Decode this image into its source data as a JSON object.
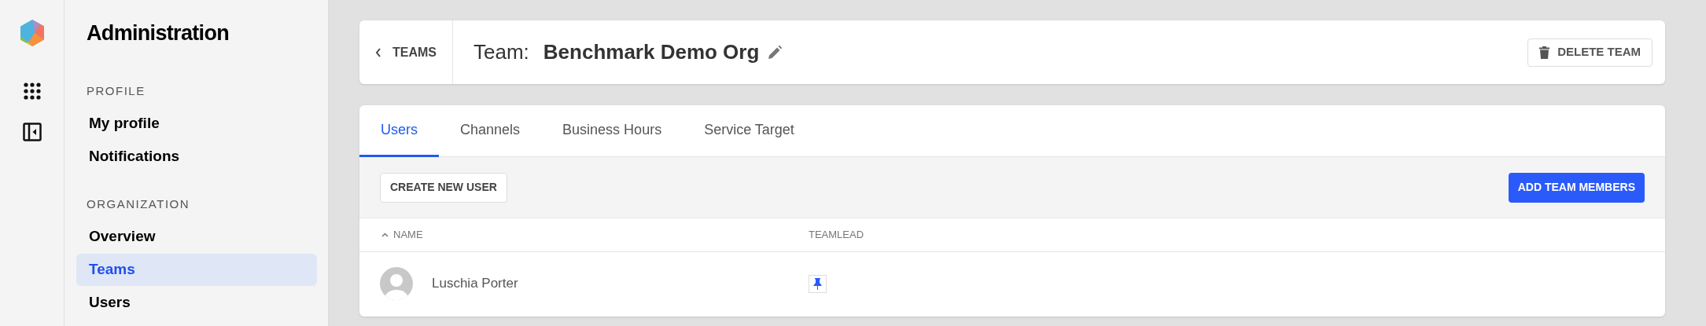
{
  "sidebar": {
    "title": "Administration",
    "sections": [
      {
        "heading": "PROFILE",
        "items": [
          {
            "label": "My profile",
            "selected": false
          },
          {
            "label": "Notifications",
            "selected": false
          }
        ]
      },
      {
        "heading": "ORGANIZATION",
        "items": [
          {
            "label": "Overview",
            "selected": false
          },
          {
            "label": "Teams",
            "selected": true
          },
          {
            "label": "Users",
            "selected": false
          }
        ]
      }
    ]
  },
  "header": {
    "back": "TEAMS",
    "title_label": "Team:",
    "title": "Benchmark Demo Org",
    "delete_button": "DELETE TEAM"
  },
  "tabs": [
    {
      "label": "Users",
      "selected": true
    },
    {
      "label": "Channels",
      "selected": false
    },
    {
      "label": "Business Hours",
      "selected": false
    },
    {
      "label": "Service Target",
      "selected": false
    }
  ],
  "toolbar": {
    "create_button": "CREATE NEW USER",
    "add_button": "ADD TEAM MEMBERS"
  },
  "table": {
    "columns": [
      {
        "label": "NAME",
        "sorted": true
      },
      {
        "label": "TEAMLEAD",
        "sorted": false
      }
    ],
    "rows": [
      {
        "name": "Luschia Porter",
        "teamlead": true
      }
    ]
  }
}
